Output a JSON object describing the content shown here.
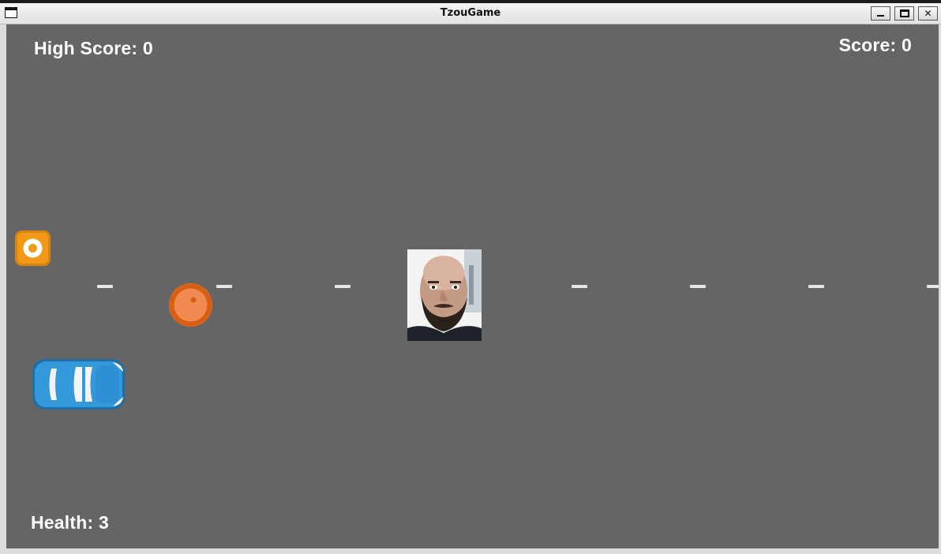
{
  "window": {
    "title": "TzouGame"
  },
  "hud": {
    "high_score_label": "High Score: 0",
    "score_label": "Score: 0",
    "health_label": "Health: 3"
  },
  "game": {
    "background_color": "#656565",
    "lane_dash_color": "#e6e6e6",
    "entities": [
      {
        "name": "powerup-ring",
        "color": "#f29a18"
      },
      {
        "name": "orange-ball",
        "color": "#e56a1b"
      },
      {
        "name": "player-face-photo"
      },
      {
        "name": "blue-car",
        "color": "#2f8fd4"
      }
    ]
  }
}
